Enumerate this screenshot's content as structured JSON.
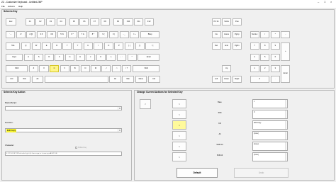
{
  "window": {
    "title": "ZZ - Customize Keyboard - Untitled.ZMP"
  },
  "menu": [
    {
      "name": "menu-file",
      "label": "File"
    },
    {
      "name": "menu-actions",
      "label": "Actions"
    },
    {
      "name": "menu-help",
      "label": "Help"
    }
  ],
  "select_key": {
    "title": "Select a Key",
    "rows": [
      {
        "keys": [
          {
            "label": "Esc"
          },
          {
            "label": "F1"
          },
          {
            "label": "F2"
          },
          {
            "label": "F3"
          },
          {
            "label": "F4"
          },
          {
            "label": "F5"
          },
          {
            "label": "F6"
          },
          {
            "label": "F7"
          },
          {
            "label": "F8"
          },
          {
            "label": "F9"
          },
          {
            "label": "F10"
          },
          {
            "label": "F11"
          },
          {
            "label": "F12"
          },
          {
            "label": "Prt Sc"
          },
          {
            "label": "ScrLk"
          },
          {
            "label": "Pau"
          }
        ]
      },
      {
        "keys": [
          {
            "label": "` ~"
          },
          {
            "label": "1 !"
          },
          {
            "label": "2 @"
          },
          {
            "label": "3 #"
          },
          {
            "label": "4 $"
          },
          {
            "label": "5 %"
          },
          {
            "label": "6 ^"
          },
          {
            "label": "7 &"
          },
          {
            "label": "8 *"
          },
          {
            "label": "9 ("
          },
          {
            "label": "0 )"
          },
          {
            "label": "- _"
          },
          {
            "label": "= +"
          },
          {
            "label": "Bksp"
          },
          {
            "label": "Ins"
          },
          {
            "label": "Home"
          },
          {
            "label": "PgUp"
          },
          {
            "label": "NumLk"
          },
          {
            "label": "/"
          },
          {
            "label": "*"
          },
          {
            "label": "-"
          }
        ]
      },
      {
        "keys": [
          {
            "label": "Tab"
          },
          {
            "label": "Q"
          },
          {
            "label": "W"
          },
          {
            "label": "E"
          },
          {
            "label": "R"
          },
          {
            "label": "T"
          },
          {
            "label": "Y"
          },
          {
            "label": "U"
          },
          {
            "label": "I"
          },
          {
            "label": "O"
          },
          {
            "label": "P"
          },
          {
            "label": "[ {"
          },
          {
            "label": "] }"
          },
          {
            "label": "\\ |"
          },
          {
            "label": "Del"
          },
          {
            "label": "End"
          },
          {
            "label": "PgDn"
          },
          {
            "label": "7"
          },
          {
            "label": "8"
          },
          {
            "label": "9"
          },
          {
            "label": "+"
          }
        ]
      },
      {
        "keys": [
          {
            "label": "Caps"
          },
          {
            "label": "A"
          },
          {
            "label": "S"
          },
          {
            "label": "D"
          },
          {
            "label": "F"
          },
          {
            "label": "G"
          },
          {
            "label": "H"
          },
          {
            "label": "J"
          },
          {
            "label": "K"
          },
          {
            "label": "L"
          },
          {
            "label": "; :"
          },
          {
            "label": "' \""
          },
          {
            "label": "Enter"
          },
          {
            "label": "4"
          },
          {
            "label": "5"
          },
          {
            "label": "6"
          }
        ]
      },
      {
        "keys": [
          {
            "label": "Shift"
          },
          {
            "label": "Z"
          },
          {
            "label": "X"
          },
          {
            "label": "C"
          },
          {
            "label": "V"
          },
          {
            "label": "B"
          },
          {
            "label": "N"
          },
          {
            "label": "M"
          },
          {
            "label": ", <"
          },
          {
            "label": ". >"
          },
          {
            "label": "/ ?"
          },
          {
            "label": "Shift"
          },
          {
            "label": "Up"
          },
          {
            "label": "1"
          },
          {
            "label": "2"
          },
          {
            "label": "3"
          },
          {
            "label": "Enter"
          }
        ]
      },
      {
        "keys": [
          {
            "label": "Ctrl"
          },
          {
            "label": "Win"
          },
          {
            "label": "Alt"
          },
          {
            "label": ""
          },
          {
            "label": "Alt"
          },
          {
            "label": "Win"
          },
          {
            "label": "Menu"
          },
          {
            "label": "Ctrl"
          },
          {
            "label": "Left"
          },
          {
            "label": "Down"
          },
          {
            "label": "Right"
          },
          {
            "label": "0"
          },
          {
            "label": "."
          }
        ]
      }
    ]
  },
  "key_action": {
    "title": "Select a Key Action",
    "macro_label": "Macro/Script:",
    "macro_value": "",
    "function_label": "Function:",
    "function_value": "Edit Copy",
    "character_label": "Character:",
    "character_value": "0 1 2 3 4 5 6 7 8 9 a b c d e f g h i j k l m n o p q r s t u v w x y z A B C D E",
    "shifted_key_label": "Shifted Key"
  },
  "change_actions": {
    "title": "Change Current Actions for Selected Key",
    "left_button": "<",
    "arrow_buttons": [
      ">",
      ">",
      ">",
      ">",
      ">",
      ">"
    ],
    "modifiers": [
      "Base",
      "Shift",
      "Ctrl",
      "Alt",
      "Shift Ctrl",
      "Shift Alt"
    ],
    "values": [
      "c",
      "C",
      "Edit Copy",
      "[none]",
      "[none]",
      "[none]"
    ],
    "default_button": "Default",
    "undo_button": "Undo"
  }
}
